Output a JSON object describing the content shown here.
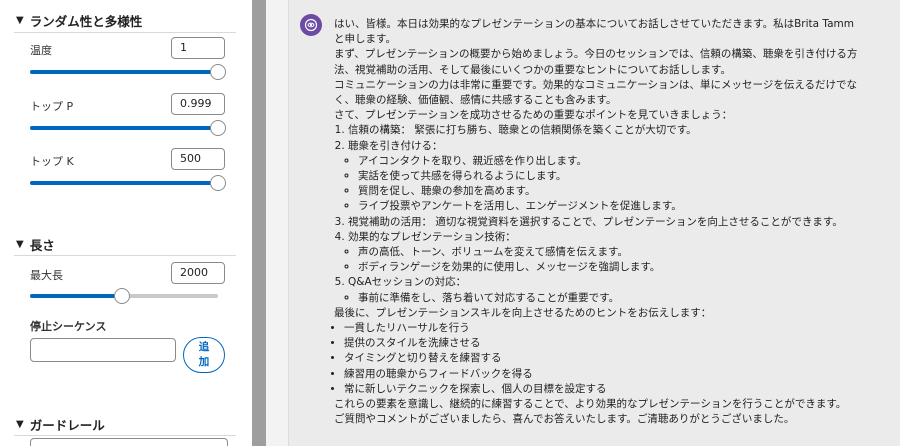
{
  "sidebar": {
    "randomness": {
      "title": "ランダム性と多様性",
      "temperature": {
        "label": "温度",
        "value": "1",
        "slider_fraction": 1.0
      },
      "top_p": {
        "label": "トップ P",
        "value": "0.999",
        "slider_fraction": 1.0
      },
      "top_k": {
        "label": "トップ K",
        "value": "500",
        "slider_fraction": 1.0
      }
    },
    "length": {
      "title": "長さ",
      "max_length": {
        "label": "最大長",
        "value": "2000",
        "slider_fraction": 0.49
      },
      "stop_sequences": {
        "label": "停止シーケンス",
        "value": "",
        "add_label": "追加"
      }
    },
    "guardrails": {
      "title": "ガードレール"
    }
  },
  "icons": {
    "section_caret": "caret-down-icon",
    "avatar": "assistant-avatar-icon"
  },
  "colors": {
    "accent": "#0067c0",
    "avatar": "#6b4ba3"
  },
  "message": {
    "intro": [
      "はい、皆様。本日は効果的なプレゼンテーションの基本についてお話しさせていただきます。私はBrita Tamm と申します。",
      "まず、プレゼンテーションの概要から始めましょう。今日のセッションでは、信頼の構築、聴衆を引き付ける方法、視覚補助の活用、そして最後にいくつかの重要なヒントについてお話しします。",
      "コミュニケーションの力は非常に重要です。効果的なコミュニケーションは、単にメッセージを伝えるだけでなく、聴衆の経験、価値観、感情に共感することも含みます。",
      "さて、プレゼンテーションを成功させるための重要なポイントを見ていきましょう："
    ],
    "points": [
      {
        "text": "信頼の構築： 緊張に打ち勝ち、聴衆との信頼関係を築くことが大切です。",
        "sub": []
      },
      {
        "text": "聴衆を引き付ける：",
        "sub": [
          "アイコンタクトを取り、親近感を作り出します。",
          "実話を使って共感を得られるようにします。",
          "質問を促し、聴衆の参加を高めます。",
          "ライブ投票やアンケートを活用し、エンゲージメントを促進します。"
        ]
      },
      {
        "text": "視覚補助の活用： 適切な視覚資料を選択することで、プレゼンテーションを向上させることができます。",
        "sub": []
      },
      {
        "text": "効果的なプレゼンテーション技術：",
        "sub": [
          "声の高低、トーン、ボリュームを変えて感情を伝えます。",
          "ボディランゲージを効果的に使用し、メッセージを強調します。"
        ]
      },
      {
        "text": "Q&Aセッションの対応：",
        "sub": [
          "事前に準備をし、落ち着いて対応することが重要です。"
        ]
      }
    ],
    "tips_intro": "最後に、プレゼンテーションスキルを向上させるためのヒントをお伝えします：",
    "tips": [
      "一貫したリハーサルを行う",
      "提供のスタイルを洗練させる",
      "タイミングと切り替えを練習する",
      "練習用の聴衆からフィードバックを得る",
      "常に新しいテクニックを探索し、個人の目標を設定する"
    ],
    "closing": [
      "これらの要素を意識し、継続的に練習することで、より効果的なプレゼンテーションを行うことができます。",
      "ご質問やコメントがございましたら、喜んでお答えいたします。ご清聴ありがとうございました。"
    ]
  }
}
